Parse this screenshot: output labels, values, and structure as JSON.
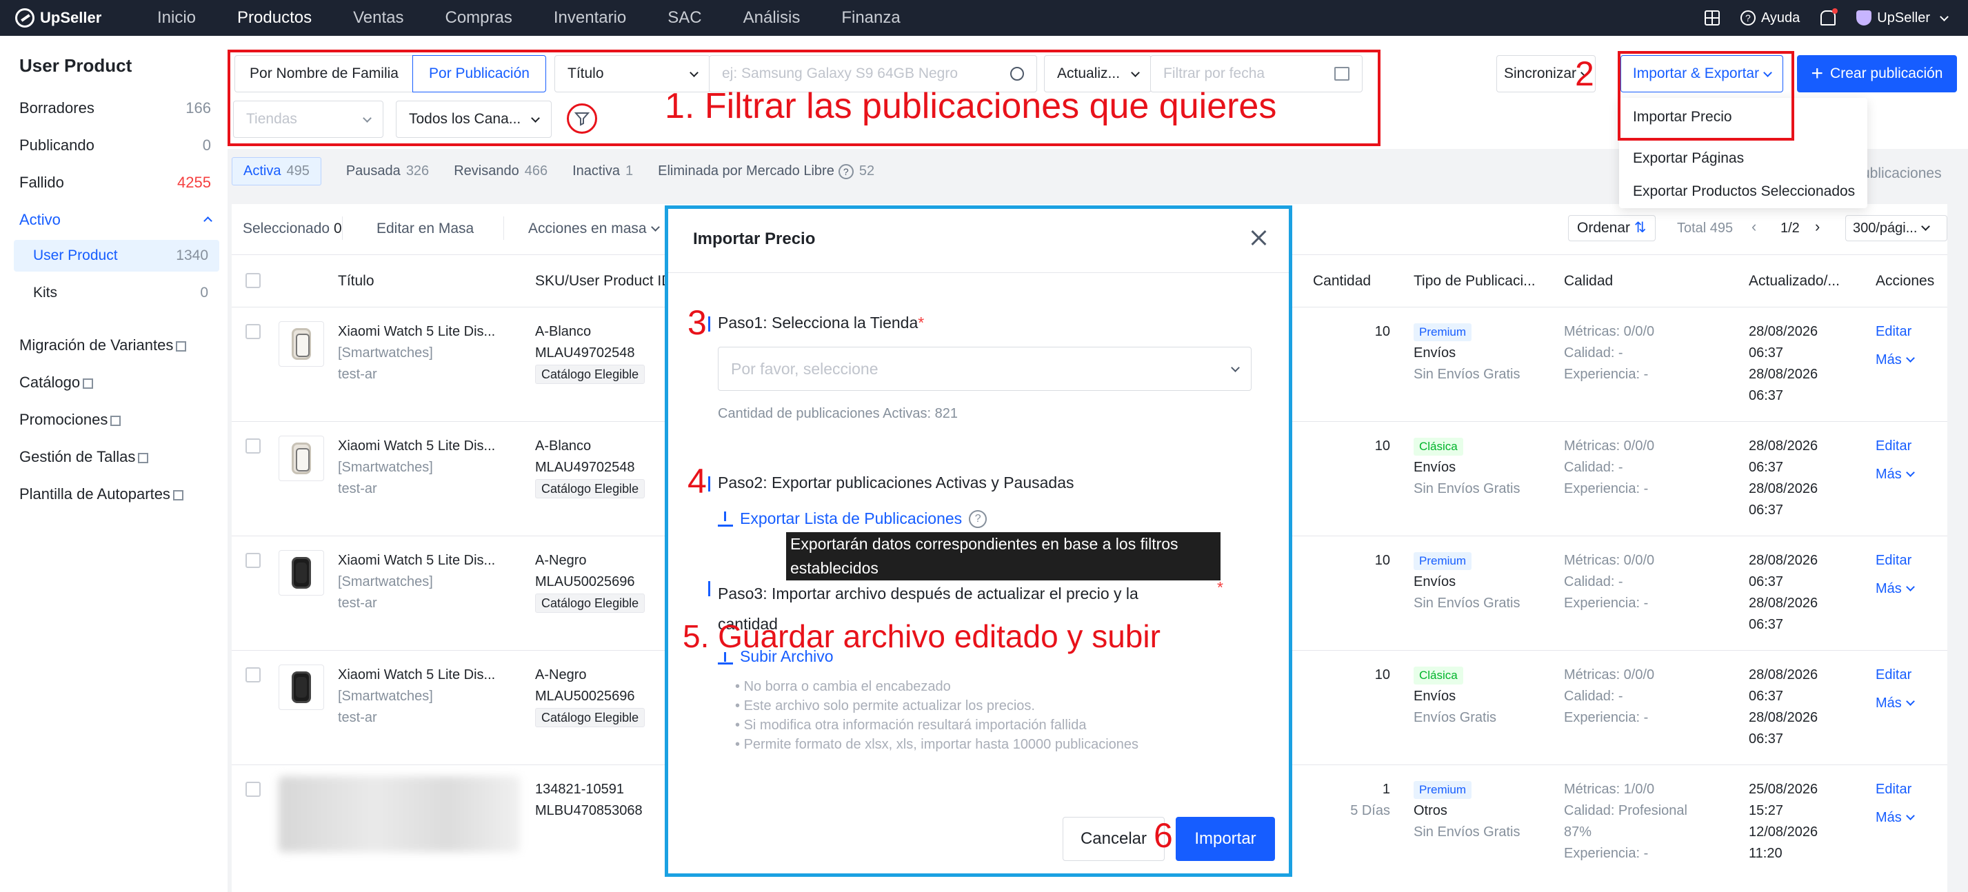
{
  "app": {
    "name": "UpSeller"
  },
  "topnav": {
    "items": [
      "Inicio",
      "Productos",
      "Ventas",
      "Compras",
      "Inventario",
      "SAC",
      "Análisis",
      "Finanza"
    ],
    "help": "Ayuda",
    "account": "UpSeller"
  },
  "sidebar": {
    "title": "User Product",
    "items": [
      {
        "label": "Borradores",
        "count": "166"
      },
      {
        "label": "Publicando",
        "count": "0"
      },
      {
        "label": "Fallido",
        "count": "4255"
      },
      {
        "label": "Activo"
      }
    ],
    "subitems": [
      {
        "label": "User Product",
        "count": "1340"
      },
      {
        "label": "Kits",
        "count": "0"
      }
    ],
    "links": [
      "Migración de Variantes",
      "Catálogo",
      "Promociones",
      "Gestión de Tallas",
      "Plantilla de Autopartes"
    ]
  },
  "filters": {
    "by_family": "Por Nombre de Familia",
    "by_publication": "Por Publicación",
    "title_select": "Título",
    "search_placeholder": "ej: Samsung Galaxy S9 64GB Negro",
    "update_select": "Actualiz...",
    "date_placeholder": "Filtrar por fecha",
    "stores_placeholder": "Tiendas",
    "channels": "Todos los Cana..."
  },
  "actions": {
    "sync": "Sincronizar",
    "import_export": "Importar & Exportar",
    "create": "Crear publicación"
  },
  "dropdown": [
    "Importar Precio",
    "Exportar Páginas",
    "Exportar Productos Seleccionados"
  ],
  "hidden_text": "ublicaciones",
  "annotations": {
    "a1": "1. Filtrar las publicaciones que quieres",
    "a2": "2",
    "a3": "3",
    "a4": "4",
    "a5": "5. Guardar archivo editado y subir",
    "a6": "6",
    "color": "#e8121a"
  },
  "tabs": [
    {
      "label": "Activa",
      "count": "495"
    },
    {
      "label": "Pausada",
      "count": "326"
    },
    {
      "label": "Revisando",
      "count": "466"
    },
    {
      "label": "Inactiva",
      "count": "1"
    },
    {
      "label": "Eliminada por Mercado Libre",
      "count": "52"
    }
  ],
  "toolbar": {
    "selected_label": "Seleccionado",
    "selected_count": "0",
    "bulk_edit": "Editar en Masa",
    "bulk_actions": "Acciones en masa",
    "sort": "Ordenar",
    "total": "Total 495",
    "page": "1/2",
    "per_page": "300/pági..."
  },
  "table": {
    "headers": [
      "Título",
      "SKU/User Product ID",
      "Cantidad",
      "Tipo de Publicaci...",
      "Calidad",
      "Actualizado/...",
      "Acciones"
    ],
    "rows": [
      {
        "title": "Xiaomi Watch 5 Lite Dis...",
        "category": "[Smartwatches]",
        "store": "test-ar",
        "sku": "A-Blanco",
        "id": "MLAU49702548",
        "tag": "Catálogo Elegible",
        "qty": "10",
        "qty2": "",
        "type": "Premium",
        "ship": "Envíos",
        "shipnote": "Sin Envíos Gratis",
        "metrics": "Métricas: 0/0/0",
        "quality": "Calidad: -",
        "experience": "Experiencia: -",
        "d1": "28/08/2026",
        "t1": "06:37",
        "d2": "28/08/2026",
        "t2": "06:37",
        "edit": "Editar",
        "more": "Más"
      },
      {
        "title": "Xiaomi Watch 5 Lite Dis...",
        "category": "[Smartwatches]",
        "store": "test-ar",
        "sku": "A-Blanco",
        "id": "MLAU49702548",
        "tag": "Catálogo Elegible",
        "qty": "10",
        "qty2": "",
        "type": "Clásica",
        "ship": "Envíos",
        "shipnote": "Sin Envíos Gratis",
        "metrics": "Métricas: 0/0/0",
        "quality": "Calidad: -",
        "experience": "Experiencia: -",
        "d1": "28/08/2026",
        "t1": "06:37",
        "d2": "28/08/2026",
        "t2": "06:37",
        "edit": "Editar",
        "more": "Más"
      },
      {
        "title": "Xiaomi Watch 5 Lite Dis...",
        "category": "[Smartwatches]",
        "store": "test-ar",
        "sku": "A-Negro",
        "id": "MLAU50025696",
        "tag": "Catálogo Elegible",
        "qty": "10",
        "qty2": "",
        "type": "Premium",
        "ship": "Envíos",
        "shipnote": "Sin Envíos Gratis",
        "metrics": "Métricas: 0/0/0",
        "quality": "Calidad: -",
        "experience": "Experiencia: -",
        "d1": "28/08/2026",
        "t1": "06:37",
        "d2": "28/08/2026",
        "t2": "06:37",
        "edit": "Editar",
        "more": "Más"
      },
      {
        "title": "Xiaomi Watch 5 Lite Dis...",
        "category": "[Smartwatches]",
        "store": "test-ar",
        "sku": "A-Negro",
        "id": "MLAU50025696",
        "tag": "Catálogo Elegible",
        "qty": "10",
        "qty2": "",
        "type": "Clásica",
        "ship": "Envíos",
        "shipnote": "Envíos Gratis",
        "metrics": "Métricas: 0/0/0",
        "quality": "Calidad: -",
        "experience": "Experiencia: -",
        "d1": "28/08/2026",
        "t1": "06:37",
        "d2": "28/08/2026",
        "t2": "06:37",
        "edit": "Editar",
        "more": "Más"
      },
      {
        "title": "",
        "category": "",
        "store": "",
        "sku": "134821-10591",
        "id": "MLBU470853068",
        "tag": "",
        "qty": "1",
        "qty2": "5 Días",
        "type": "Premium",
        "ship": "Otros",
        "shipnote": "Sin Envíos Gratis",
        "metrics": "Métricas: 1/0/0",
        "quality": "Calidad: Profesional",
        "quality2": "87%",
        "experience": "Experiencia: -",
        "d1": "25/08/2026",
        "t1": "15:27",
        "d2": "12/08/2026",
        "t2": "11:20",
        "edit": "Editar",
        "more": "Más"
      }
    ]
  },
  "modal": {
    "title": "Importar Precio",
    "step1": "Paso1: Selecciona la Tienda",
    "step1_placeholder": "Por favor, seleccione",
    "step1_note": "Cantidad de publicaciones Activas: 821",
    "step2": "Paso2: Exportar publicaciones Activas y Pausadas",
    "export_link": "Exportar Lista de Publicaciones",
    "tooltip": "Exportarán datos correspondientes en base a los filtros establecidos",
    "step3": "Paso3: Importar archivo después de actualizar el precio y la cantidad",
    "upload_link": "Subir Archivo",
    "bullets": [
      "No borra o cambia el encabezado",
      "Este archivo solo permite actualizar los precios.",
      "Si modifica otra información resultará importación fallida",
      "Permite formato de xlsx, xls, importar hasta 10000 publicaciones"
    ],
    "cancel": "Cancelar",
    "import": "Importar"
  }
}
